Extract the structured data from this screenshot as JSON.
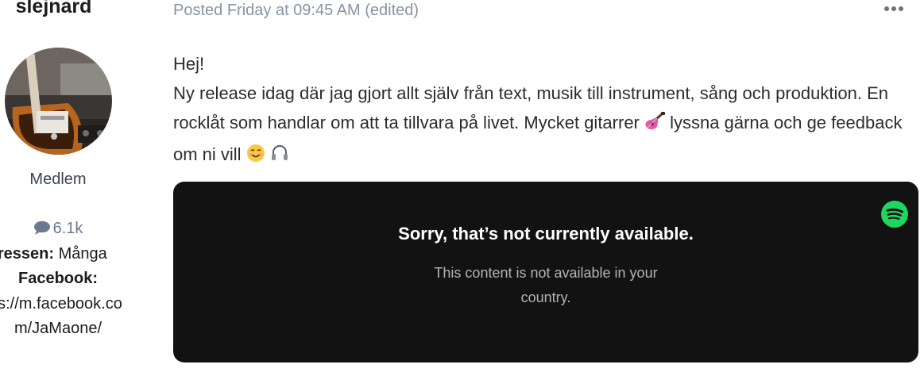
{
  "author": {
    "name": "slejnard",
    "rank": "Medlem",
    "post_count": "6.1k",
    "fields": {
      "intressen_label": "ntressen:",
      "intressen_value": "Många",
      "facebook_label": "Facebook:",
      "facebook_url_line1": "os://m.facebook.co",
      "facebook_url_line2": "m/JaMaone/"
    }
  },
  "post": {
    "meta": "Posted Friday at 09:45 AM (edited)",
    "greeting": "Hej!",
    "body_part1": "Ny release idag där jag gjort allt själv från text, musik till instrument, sång och produktion. En rocklåt som handlar om att ta tillvara på livet. Mycket gitarrer",
    "body_part2": "lyssna gärna och ge feedback om ni vill",
    "emojis": [
      "guitar-emoji",
      "smiling-face-emoji",
      "headphone-emoji"
    ]
  },
  "embed": {
    "provider_icon": "spotify-icon",
    "title": "Sorry, that’s not currently available.",
    "message_line1": "This content is not available in your",
    "message_line2": "country."
  },
  "colors": {
    "spotify_green": "#1ed760",
    "embed_background": "#121212",
    "meta_text": "#8a93a3"
  }
}
